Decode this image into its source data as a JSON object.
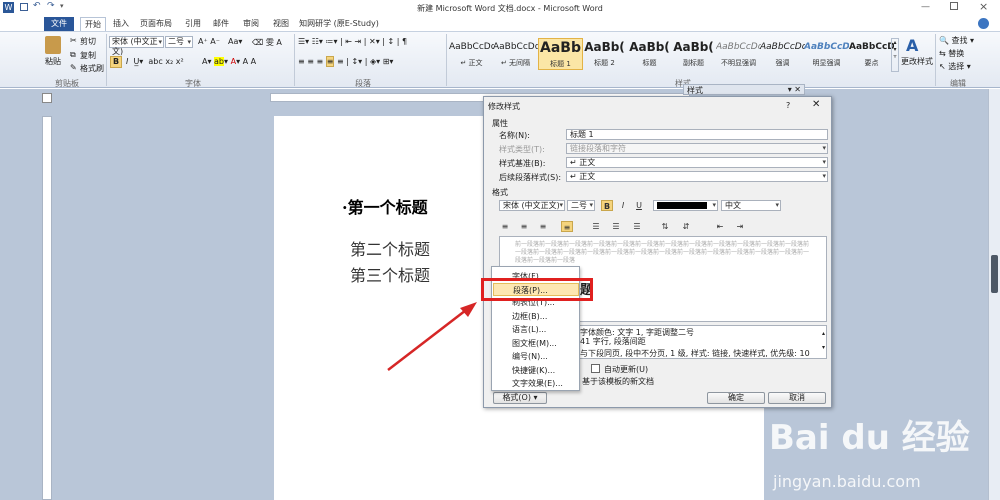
{
  "titlebar": {
    "app_icon": "W",
    "title": "新建 Microsoft Word 文档.docx - Microsoft Word"
  },
  "tabs": [
    "文件",
    "开始",
    "插入",
    "页面布局",
    "引用",
    "邮件",
    "审阅",
    "视图",
    "知网研学 (原E-Study)"
  ],
  "ribbon": {
    "clipboard": {
      "paste": "粘贴",
      "cut": "剪切",
      "copy": "复制",
      "format_painter": "格式刷",
      "group": "剪贴板"
    },
    "font": {
      "name": "宋体 (中文正文)",
      "size": "二号",
      "group": "字体"
    },
    "paragraph": {
      "group": "段落"
    },
    "styles": [
      {
        "preview": "AaBbCcDd",
        "name": "↵ 正文"
      },
      {
        "preview": "AaBbCcDd",
        "name": "↵ 无间隔"
      },
      {
        "preview": "AaBb",
        "name": "标题 1"
      },
      {
        "preview": "AaBb(",
        "name": "标题 2"
      },
      {
        "preview": "AaBb(",
        "name": "标题"
      },
      {
        "preview": "AaBb(",
        "name": "副标题"
      },
      {
        "preview": "AaBbCcDd",
        "name": "不明显强调"
      },
      {
        "preview": "AaBbCcDd",
        "name": "强调"
      },
      {
        "preview": "AaBbCcDc",
        "name": "明显强调"
      },
      {
        "preview": "AaBbCcDc",
        "name": "要点"
      }
    ],
    "styles_group": "样式",
    "change_styles": "更改样式",
    "editing": {
      "find": "查找",
      "replace": "替换",
      "select": "选择",
      "group": "编辑"
    }
  },
  "styles_pane_title": "样式",
  "document": {
    "headings": [
      "·第一个标题",
      "第二个标题",
      "第三个标题"
    ]
  },
  "dialog": {
    "title": "修改样式",
    "help": "?",
    "properties_label": "属性",
    "name_label": "名称(N):",
    "name_value": "标题 1",
    "type_label": "样式类型(T):",
    "type_value": "链接段落和字符",
    "based_label": "样式基准(B):",
    "based_value": "↵ 正文",
    "next_label": "后续段落样式(S):",
    "next_value": "↵ 正文",
    "format_label": "格式",
    "font_value": "宋体 (中文正文)",
    "size_value": "二号",
    "bold": "B",
    "italic": "I",
    "underline": "U",
    "lang_value": "中文",
    "preview_text": "前一段落前一段落前一段落前一段落前一段落前一段落前一段落前一段落前一段落前一段落前一段落前一段落前一段落前一段落前一段落前一段落前一段落前一段落前一段落前一段落前一段落前一段落前一段落前一段落前一段落前一段落前一段落",
    "preview_heading": "题",
    "desc_line1": "字体颜色: 文字 1, 字距调整二号",
    "desc_line2": "41 字行, 段落间距",
    "desc_line3": "与下段同页, 段中不分页, 1 级, 样式: 链接, 快速样式, 优先级: 10",
    "auto_update": "自动更新(U)",
    "template_option": "基于该模板的新文档",
    "format_button": "格式(O) ▾",
    "ok": "确定",
    "cancel": "取消"
  },
  "format_menu": [
    "字体(F)...",
    "段落(P)...",
    "制表位(T)...",
    "边框(B)...",
    "语言(L)...",
    "图文框(M)...",
    "编号(N)...",
    "快捷键(K)...",
    "文字效果(E)..."
  ],
  "highlight_color": "#e0201f",
  "arrow_color": "#d62626",
  "watermark": {
    "logo": "Bai du 经验",
    "url": "jingyan.baidu.com"
  }
}
